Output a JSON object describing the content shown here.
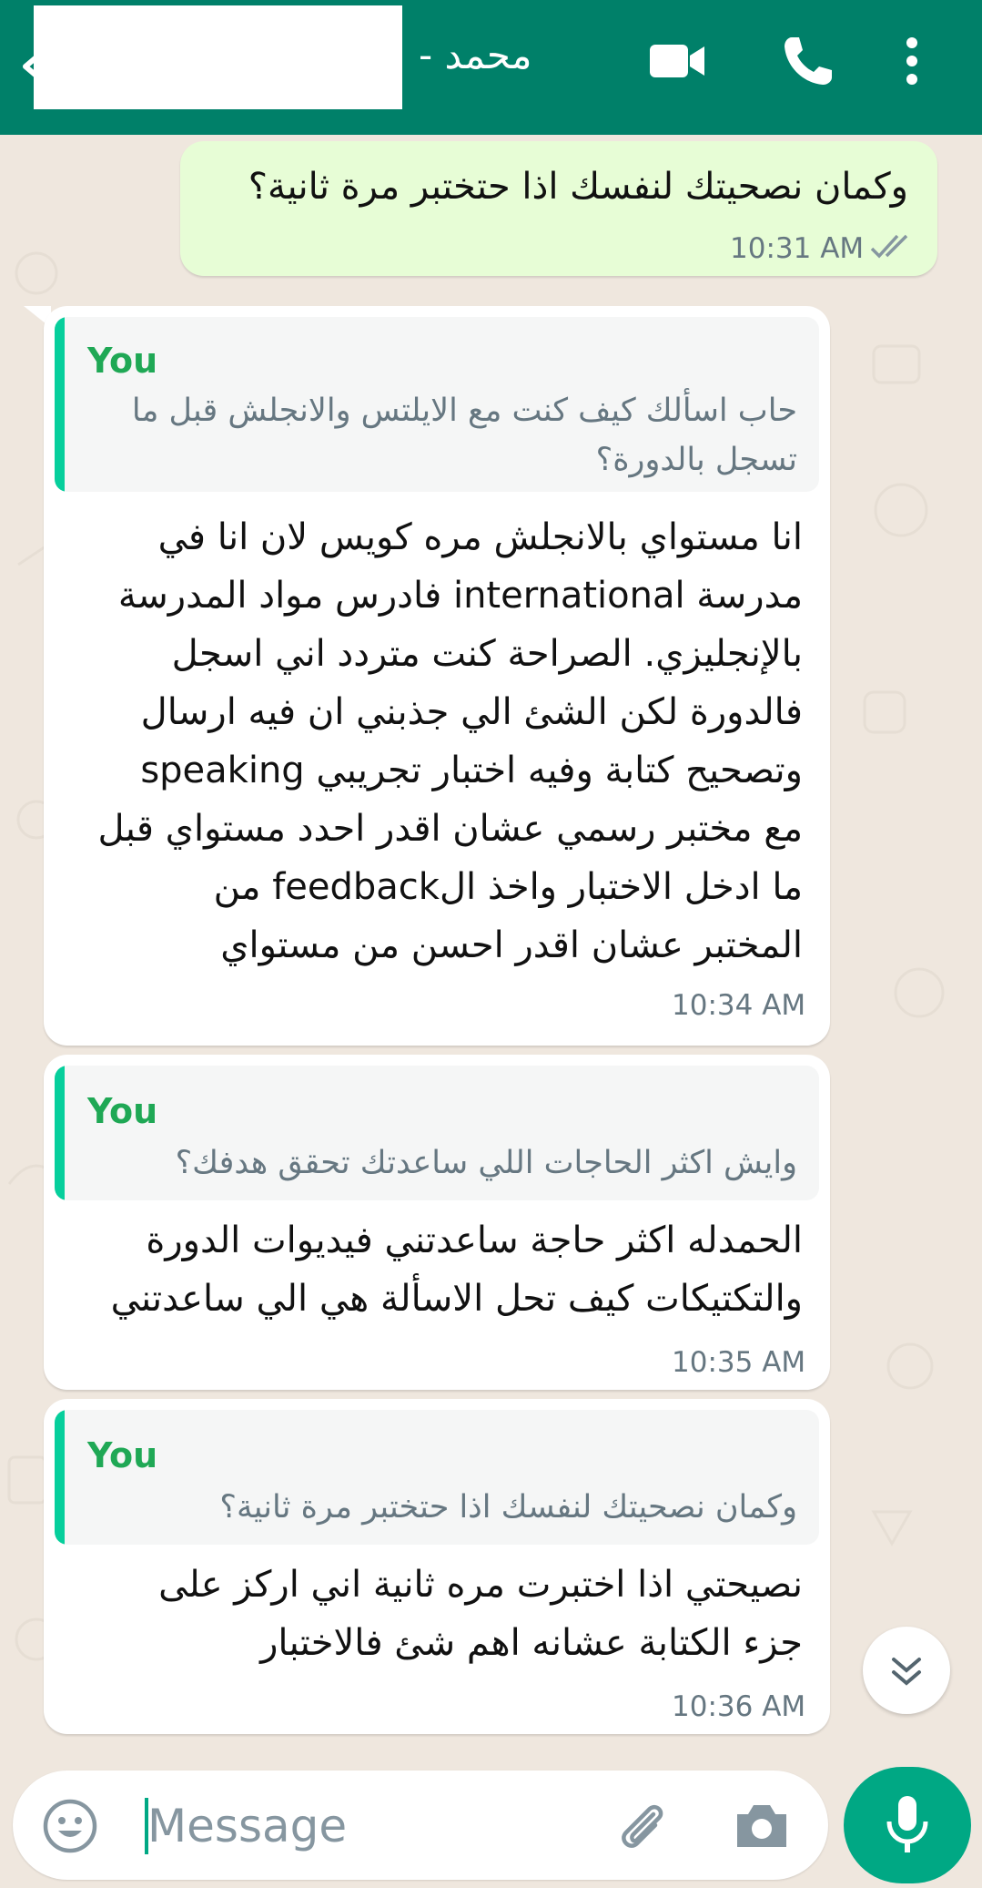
{
  "header": {
    "contact_name": "محمد -",
    "icons": {
      "back": "back-arrow-icon",
      "video": "video-call-icon",
      "phone": "voice-call-icon",
      "menu": "more-options-icon"
    }
  },
  "messages": [
    {
      "direction": "outgoing",
      "text": "وكمان نصحيتك لنفسك اذا حتختبر مرة ثانية؟",
      "time": "10:31 AM",
      "status": "read-ticks-icon"
    },
    {
      "direction": "incoming",
      "quote": {
        "author": "You",
        "text": "حاب اسألك كيف كنت مع الايلتس والانجلش قبل ما\nتسجل بالدورة؟"
      },
      "text": "انا مستواي بالانجلش مره كويس لان انا  في\nمدرسة international فادرس مواد المدرسة\nبالإنجليزي. الصراحة كنت متردد اني اسجل\nفالدورة لكن الشئ الي جذبني ان فيه ارسال\nوتصحيح كتابة وفيه اختبار تجريبي speaking\nمع مختبر رسمي عشان اقدر احدد مستواي قبل\nما ادخل الاختبار واخذ الfeedback من\nالمختبر عشان اقدر احسن من مستواي",
      "time": "10:34 AM"
    },
    {
      "direction": "incoming",
      "quote": {
        "author": "You",
        "text": "وايش اكثر الحاجات اللي ساعدتك تحقق هدفك؟"
      },
      "text": "الحمدله اكثر حاجة ساعدتني فيديوات الدورة\nوالتكتيكات كيف تحل الاسألة هي الي ساعدتني",
      "time": "10:35 AM"
    },
    {
      "direction": "incoming",
      "quote": {
        "author": "You",
        "text": "وكمان نصحيتك لنفسك اذا حتختبر مرة ثانية؟"
      },
      "text": "نصيحتي اذا اختبرت مره ثانية اني اركز على\nجزء الكتابة عشانه اهم شئ فالاختبار",
      "time": "10:36 AM"
    }
  ],
  "composer": {
    "placeholder": "Message",
    "icons": {
      "emoji": "emoji-icon",
      "attach": "paperclip-icon",
      "camera": "camera-icon",
      "mic": "microphone-icon",
      "scroll": "scroll-down-icon"
    }
  },
  "colors": {
    "header": "#008069",
    "outgoing_bubble": "#e7fdd6",
    "quote_bar": "#06cf9c",
    "mic_button": "#00a884"
  }
}
